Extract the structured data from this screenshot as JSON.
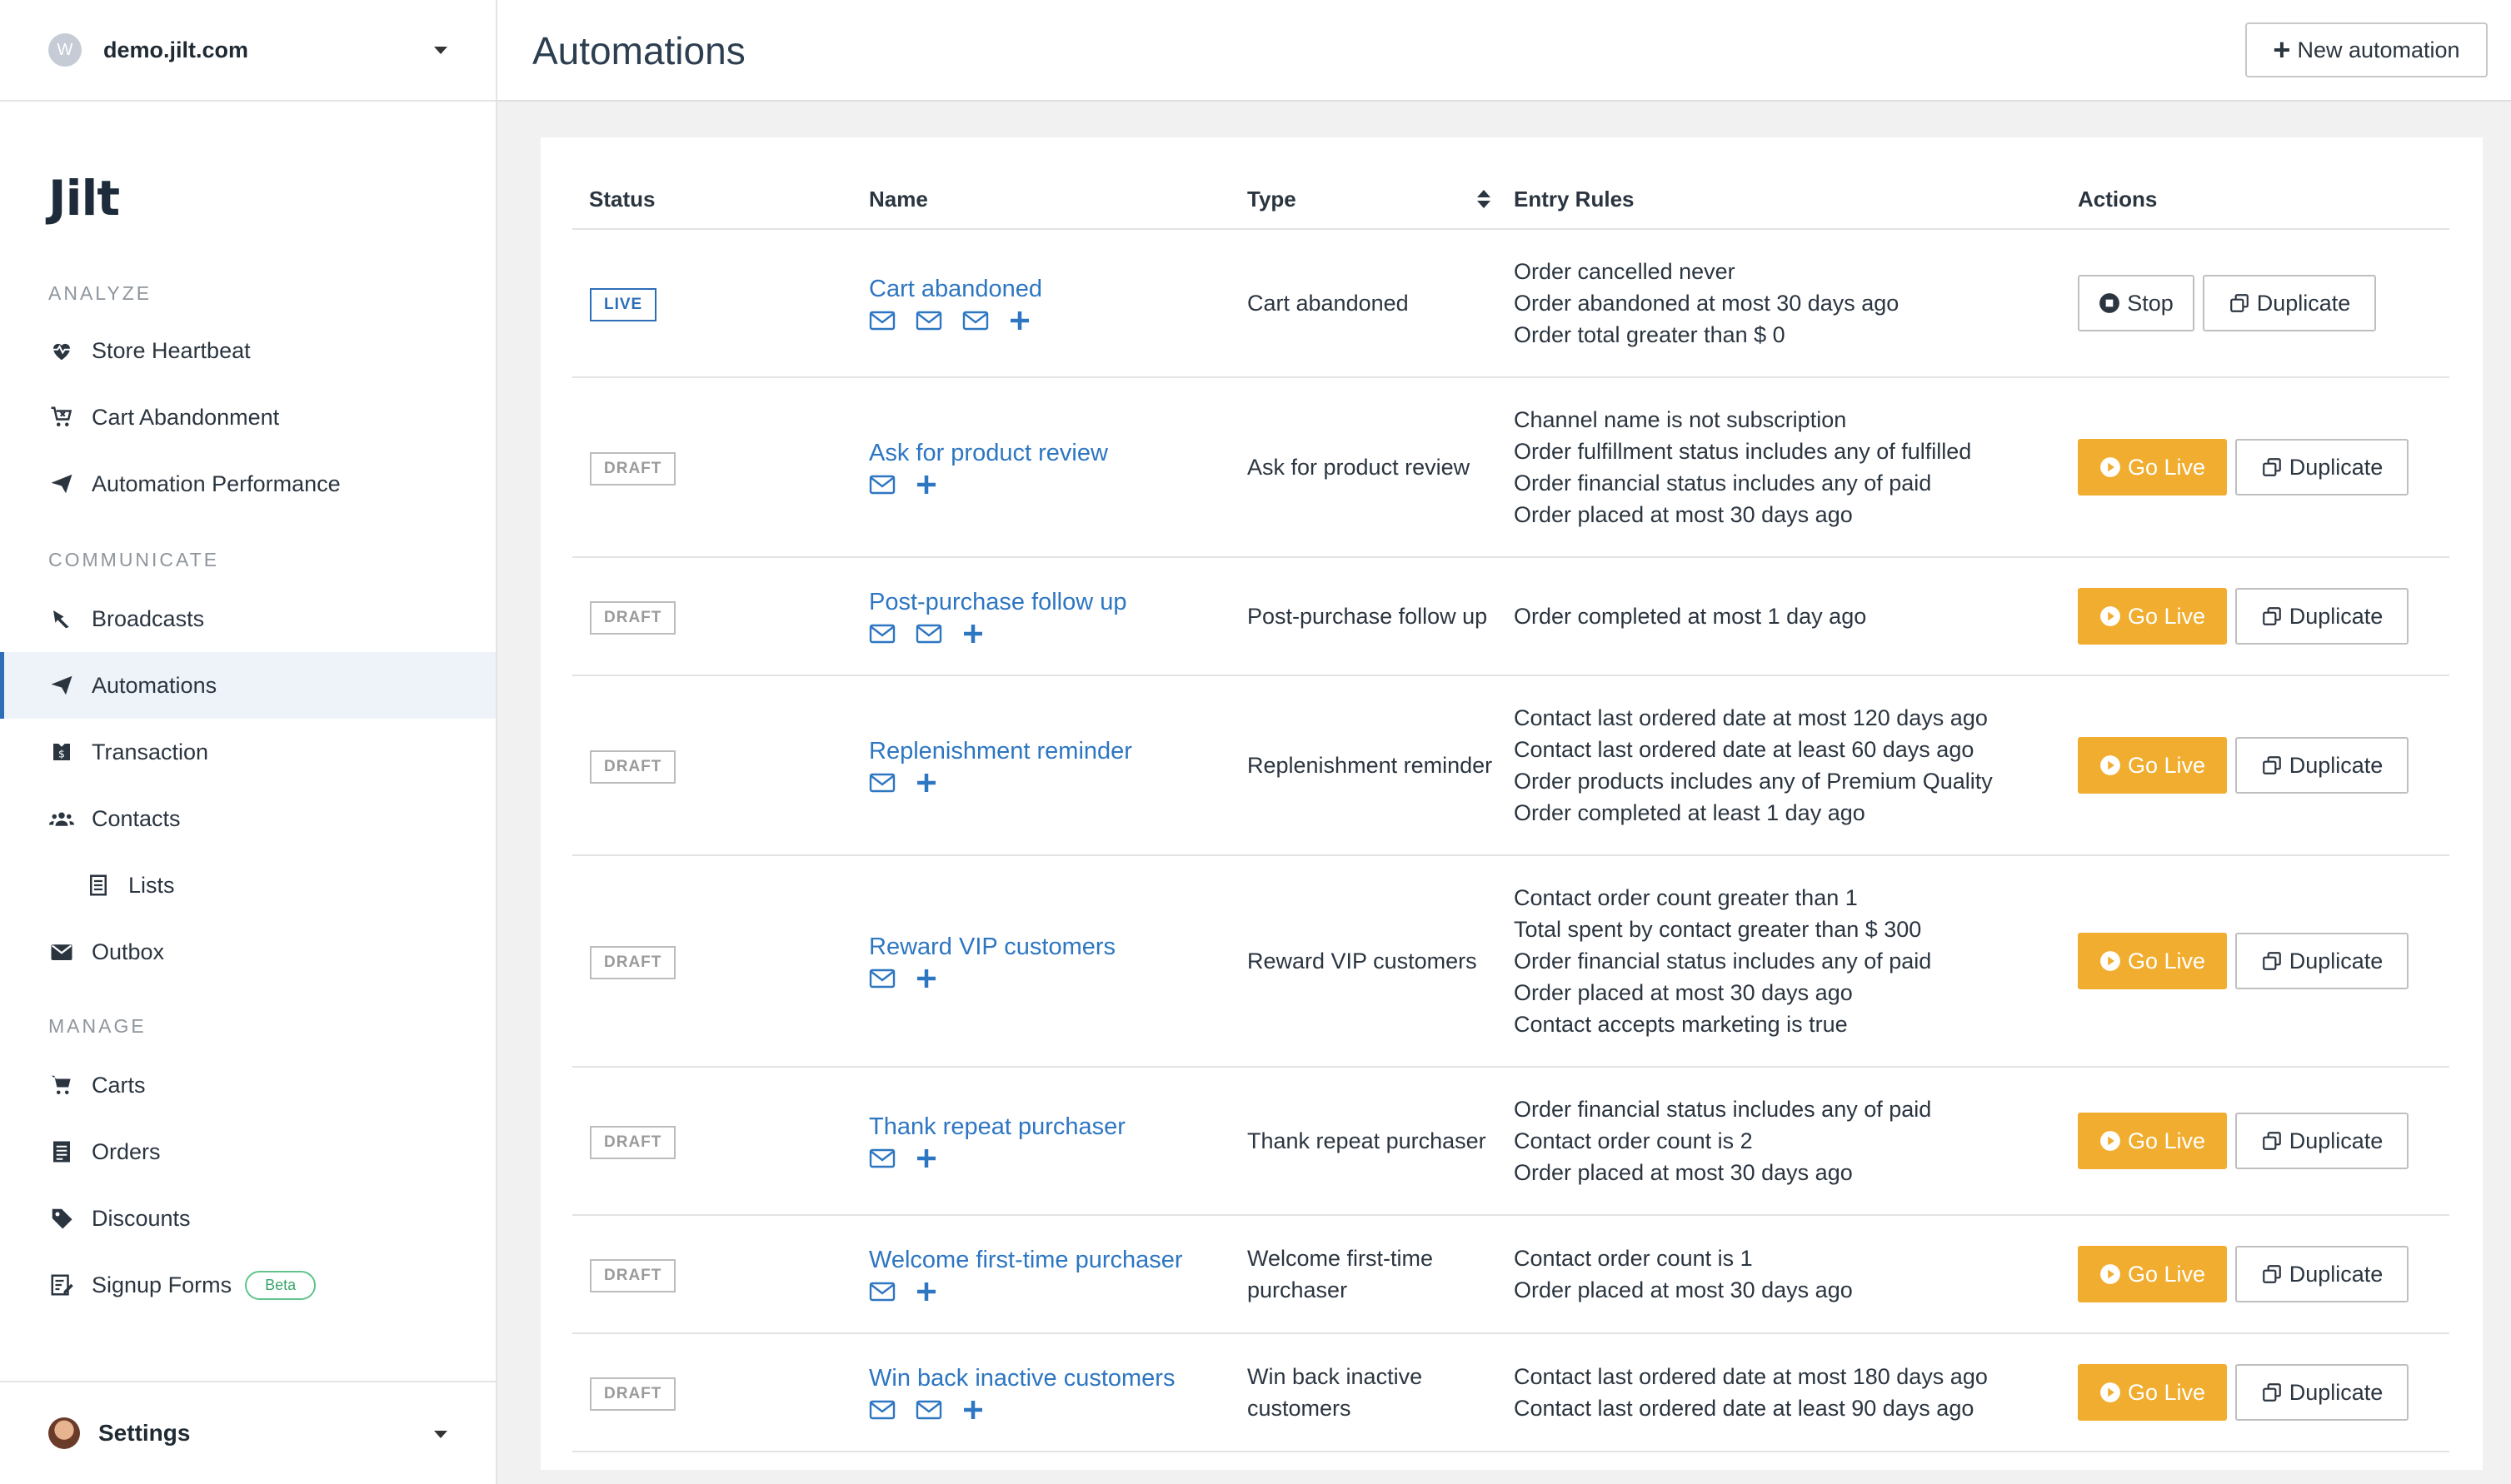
{
  "sidebar": {
    "site": {
      "avatar_letter": "W",
      "name": "demo.jilt.com"
    },
    "logo": "Jilt",
    "sections": {
      "analyze": "ANALYZE",
      "communicate": "COMMUNICATE",
      "manage": "MANAGE"
    },
    "items": {
      "store_heartbeat": "Store Heartbeat",
      "cart_abandonment": "Cart Abandonment",
      "automation_performance": "Automation Performance",
      "broadcasts": "Broadcasts",
      "automations": "Automations",
      "transaction": "Transaction",
      "contacts": "Contacts",
      "lists": "Lists",
      "outbox": "Outbox",
      "carts": "Carts",
      "orders": "Orders",
      "discounts": "Discounts",
      "signup_forms": "Signup Forms",
      "beta_badge": "Beta"
    },
    "settings": "Settings"
  },
  "header": {
    "title": "Automations",
    "new_button": "New automation"
  },
  "table": {
    "columns": {
      "status": "Status",
      "name": "Name",
      "type": "Type",
      "entry_rules": "Entry Rules",
      "actions": "Actions"
    },
    "buttons": {
      "stop": "Stop",
      "go_live": "Go Live",
      "duplicate": "Duplicate"
    },
    "rows": [
      {
        "status": "LIVE",
        "name": "Cart abandoned",
        "type": "Cart abandoned",
        "emails": 3,
        "rules": [
          "Order cancelled never",
          "Order abandoned at most 30 days ago",
          "Order total greater than $ 0"
        ]
      },
      {
        "status": "DRAFT",
        "name": "Ask for product review",
        "type": "Ask for product review",
        "emails": 1,
        "rules": [
          "Channel name is not subscription",
          "Order fulfillment status includes any of fulfilled",
          "Order financial status includes any of paid",
          "Order placed at most 30 days ago"
        ]
      },
      {
        "status": "DRAFT",
        "name": "Post-purchase follow up",
        "type": "Post-purchase follow up",
        "emails": 2,
        "rules": [
          "Order completed at most 1 day ago"
        ]
      },
      {
        "status": "DRAFT",
        "name": "Replenishment reminder",
        "type": "Replenishment reminder",
        "emails": 1,
        "rules": [
          "Contact last ordered date at most 120 days ago",
          "Contact last ordered date at least 60 days ago",
          "Order products includes any of Premium Quality",
          "Order completed at least 1 day ago"
        ]
      },
      {
        "status": "DRAFT",
        "name": "Reward VIP customers",
        "type": "Reward VIP customers",
        "emails": 1,
        "rules": [
          "Contact order count greater than 1",
          "Total spent by contact greater than $ 300",
          "Order financial status includes any of paid",
          "Order placed at most 30 days ago",
          "Contact accepts marketing is true"
        ]
      },
      {
        "status": "DRAFT",
        "name": "Thank repeat purchaser",
        "type": "Thank repeat purchaser",
        "emails": 1,
        "rules": [
          "Order financial status includes any of paid",
          "Contact order count is 2",
          "Order placed at most 30 days ago"
        ]
      },
      {
        "status": "DRAFT",
        "name": "Welcome first-time purchaser",
        "type": "Welcome first-time purchaser",
        "emails": 1,
        "rules": [
          "Contact order count is 1",
          "Order placed at most 30 days ago"
        ]
      },
      {
        "status": "DRAFT",
        "name": "Win back inactive customers",
        "type": "Win back inactive customers",
        "emails": 2,
        "rules": [
          "Contact last ordered date at most 180 days ago",
          "Contact last ordered date at least 90 days ago"
        ]
      }
    ]
  },
  "colors": {
    "accent": "#2d76c2",
    "go_live": "#f1ad2f",
    "live_badge": "#2d6eb6",
    "draft_badge": "#9a9a9a",
    "beta": "#39a56b"
  }
}
